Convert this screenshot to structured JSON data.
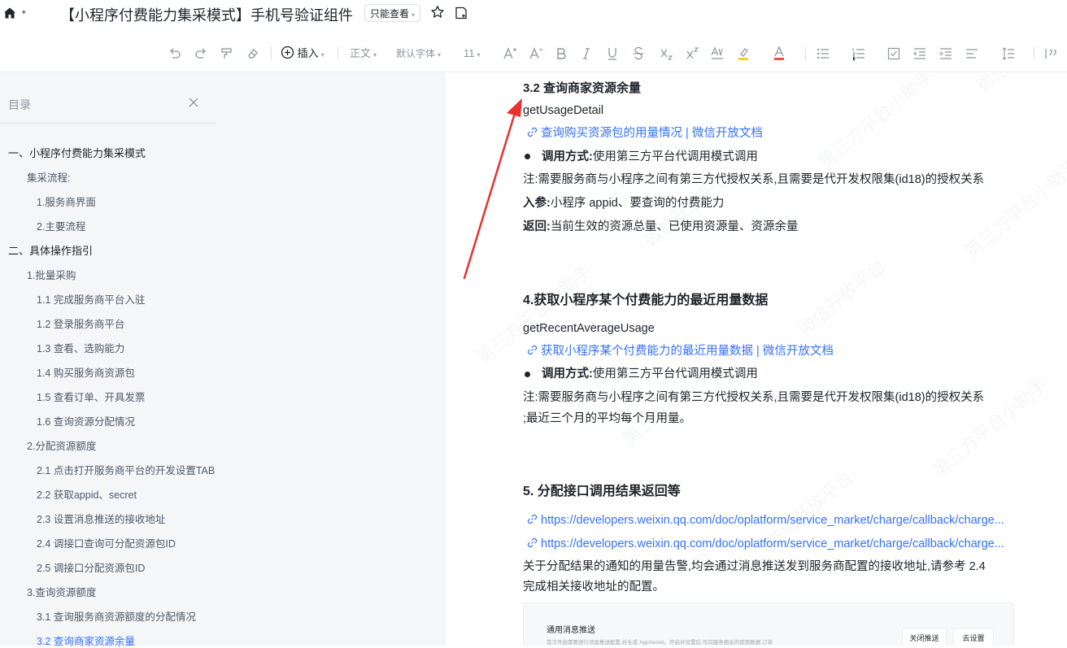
{
  "titlebar": {
    "title": "【小程序付费能力集采模式】手机号验证组件",
    "permission": "只能查看",
    "permission_caret": "▾",
    "home_caret": "▾"
  },
  "toolbar": {
    "insert": "插入",
    "style": "正文",
    "font": "默认字体",
    "size": "11",
    "caret": "▾"
  },
  "sidebar": {
    "header": "目录",
    "items": [
      {
        "label": "一、小程序付费能力集采模式",
        "level": 1
      },
      {
        "label": "集采流程:",
        "level": 2
      },
      {
        "label": "1.服务商界面",
        "level": 3
      },
      {
        "label": "2.主要流程",
        "level": 3
      },
      {
        "label": "二、具体操作指引",
        "level": 1
      },
      {
        "label": "1.批量采购",
        "level": 2
      },
      {
        "label": "1.1 完成服务商平台入驻",
        "level": 3
      },
      {
        "label": "1.2 登录服务商平台",
        "level": 3
      },
      {
        "label": "1.3 查看、选购能力",
        "level": 3
      },
      {
        "label": "1.4 购买服务商资源包",
        "level": 3
      },
      {
        "label": "1.5 查看订单、开具发票",
        "level": 3
      },
      {
        "label": "1.6 查询资源分配情况",
        "level": 3
      },
      {
        "label": "2.分配资源额度",
        "level": 2
      },
      {
        "label": "2.1 点击打开服务商平台的开发设置TAB",
        "level": 3
      },
      {
        "label": "2.2 获取appid、secret",
        "level": 3
      },
      {
        "label": "2.3 设置消息推送的接收地址",
        "level": 3
      },
      {
        "label": "2.4 调接口查询可分配资源包ID",
        "level": 3
      },
      {
        "label": "2.5 调接口分配资源包ID",
        "level": 3
      },
      {
        "label": "3.查询资源额度",
        "level": 2
      },
      {
        "label": "3.1 查询服务商资源额度的分配情况",
        "level": 3
      },
      {
        "label": "3.2 查询商家资源余量",
        "level": 3,
        "active": true
      }
    ]
  },
  "content": {
    "s32": {
      "heading": "3.2 查询商家资源余量",
      "api": "getUsageDetail",
      "link": "查询购买资源包的用量情况 | 微信开放文档",
      "call_label": "调用方式:",
      "call_text": "使用第三方平台代调用模式调用",
      "note": "注:需要服务商与小程序之间有第三方代授权关系,且需要是代开发权限集(id18)的授权关系",
      "param_label": "入参:",
      "param_text": "小程序 appid、要查询的付费能力",
      "ret_label": "返回:",
      "ret_text": "当前生效的资源总量、已使用资源量、资源余量"
    },
    "s4": {
      "heading": "4.获取小程序某个付费能力的最近用量数据",
      "api": "getRecentAverageUsage",
      "link": "获取小程序某个付费能力的最近用量数据 | 微信开放文档",
      "call_label": "调用方式:",
      "call_text": "使用第三方平台代调用模式调用",
      "note1": "注:需要服务商与小程序之间有第三方代授权关系,且需要是代开发权限集(id18)的授权关系",
      "note2": ";最近三个月的平均每个月用量。"
    },
    "s5": {
      "heading": "5. 分配接口调用结果返回等",
      "link1": "https://developers.weixin.qq.com/doc/oplatform/service_market/charge/callback/charge...",
      "link2": "https://developers.weixin.qq.com/doc/oplatform/service_market/charge/callback/charge...",
      "para1": "关于分配结果的通知的用量告警,均会通过消息推送发到服务商配置的接收地址,请参考 2.4",
      "para2": "完成相关接收地址的配置。"
    },
    "thumbnail": {
      "title": "通用消息推送",
      "desc": "首次开启需要进行消息推送配置,并生成 AppSecret。开启并设置后,可向服务相关的使用数据,订单",
      "btn1": "关闭推送",
      "btn2": "去设置"
    },
    "watermark": [
      "第三方平台小助手",
      "微信开放平台",
      "第三方平台小助手",
      "微信开放平台",
      "第三方平台小助手",
      "微信开放平台",
      "第三方平台小助手",
      "微信开放平台",
      "第三方平台小助手"
    ]
  },
  "colors": {
    "accent": "#3370ff",
    "arrow": "#e8312f",
    "sidebar_bg": "#f5f6f7"
  }
}
